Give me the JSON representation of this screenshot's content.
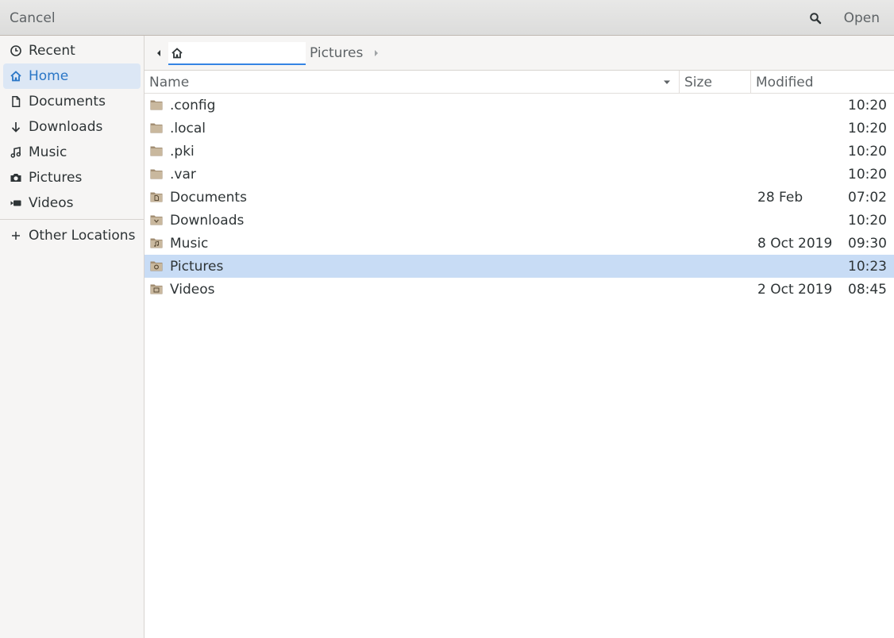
{
  "header": {
    "cancel_label": "Cancel",
    "open_label": "Open",
    "search_icon": "search-icon"
  },
  "sidebar": {
    "items": [
      {
        "label": "Recent",
        "icon": "clock-icon"
      },
      {
        "label": "Home",
        "icon": "home-icon"
      },
      {
        "label": "Documents",
        "icon": "document-icon"
      },
      {
        "label": "Downloads",
        "icon": "download-arrow-icon"
      },
      {
        "label": "Music",
        "icon": "music-note-icon"
      },
      {
        "label": "Pictures",
        "icon": "camera-icon"
      },
      {
        "label": "Videos",
        "icon": "video-camera-icon"
      }
    ],
    "other_locations": {
      "label": "Other Locations",
      "icon": "plus-icon"
    }
  },
  "pathbar": {
    "current_label": "Pictures"
  },
  "columns": {
    "name": "Name",
    "size": "Size",
    "modified": "Modified"
  },
  "files": [
    {
      "name": ".config",
      "date": "",
      "time": "10:20",
      "icon": "folder-icon"
    },
    {
      "name": ".local",
      "date": "",
      "time": "10:20",
      "icon": "folder-icon"
    },
    {
      "name": ".pki",
      "date": "",
      "time": "10:20",
      "icon": "folder-icon"
    },
    {
      "name": ".var",
      "date": "",
      "time": "10:20",
      "icon": "folder-icon"
    },
    {
      "name": "Documents",
      "date": "28 Feb",
      "time": "07:02",
      "icon": "folder-documents-icon"
    },
    {
      "name": "Downloads",
      "date": "",
      "time": "10:20",
      "icon": "folder-downloads-icon"
    },
    {
      "name": "Music",
      "date": "8 Oct 2019",
      "time": "09:30",
      "icon": "folder-music-icon"
    },
    {
      "name": "Pictures",
      "date": "",
      "time": "10:23",
      "icon": "folder-pictures-icon"
    },
    {
      "name": "Videos",
      "date": "2 Oct 2019",
      "time": "08:45",
      "icon": "folder-videos-icon"
    }
  ],
  "colors": {
    "accent": "#3584e4",
    "active_sidebar_bg": "#dce7f5",
    "selected_row_bg": "#c8dcf5",
    "folder": "#a28e73"
  }
}
